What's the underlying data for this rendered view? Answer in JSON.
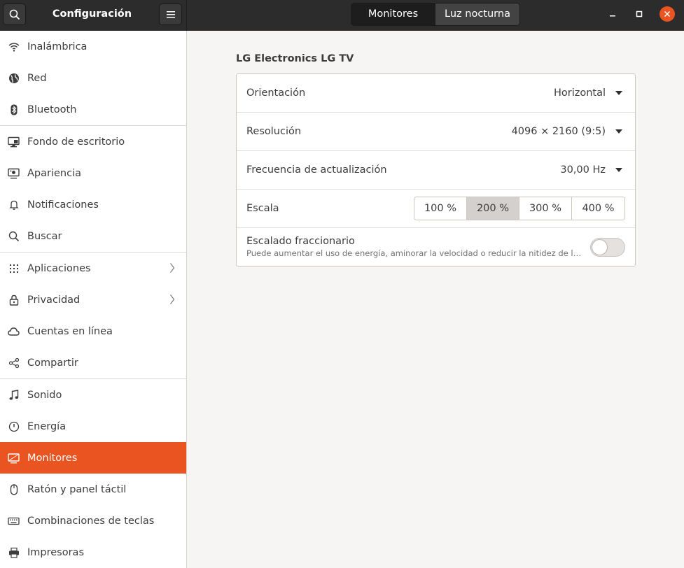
{
  "header": {
    "search_icon": "search-icon",
    "title": "Configuración",
    "menu_icon": "hamburger-icon",
    "tabs": [
      {
        "label": "Monitores"
      },
      {
        "label": "Luz nocturna"
      }
    ],
    "window_controls": [
      "minimize-icon",
      "maximize-icon",
      "close-icon"
    ]
  },
  "sidebar": {
    "items": [
      {
        "label": "Inalámbrica",
        "icon": "wifi-icon"
      },
      {
        "label": "Red",
        "icon": "network-globe-icon"
      },
      {
        "label": "Bluetooth",
        "icon": "bluetooth-icon"
      },
      {
        "label": "Fondo de escritorio",
        "icon": "wallpaper-icon"
      },
      {
        "label": "Apariencia",
        "icon": "appearance-icon"
      },
      {
        "label": "Notificaciones",
        "icon": "bell-icon"
      },
      {
        "label": "Buscar",
        "icon": "search-icon"
      },
      {
        "label": "Aplicaciones",
        "icon": "apps-grid-icon"
      },
      {
        "label": "Privacidad",
        "icon": "lock-icon"
      },
      {
        "label": "Cuentas en línea",
        "icon": "cloud-icon"
      },
      {
        "label": "Compartir",
        "icon": "share-icon"
      },
      {
        "label": "Sonido",
        "icon": "music-note-icon"
      },
      {
        "label": "Energía",
        "icon": "power-icon"
      },
      {
        "label": "Monitores",
        "icon": "display-icon"
      },
      {
        "label": "Ratón y panel táctil",
        "icon": "mouse-icon"
      },
      {
        "label": "Combinaciones de teclas",
        "icon": "keyboard-icon"
      },
      {
        "label": "Impresoras",
        "icon": "printer-icon"
      }
    ],
    "selected": "Monitores"
  },
  "main": {
    "monitor_name": "LG Electronics LG TV",
    "orientation": {
      "label": "Orientación",
      "value": "Horizontal"
    },
    "resolution": {
      "label": "Resolución",
      "value": "4096 × 2160 (9:5)"
    },
    "refresh": {
      "label": "Frecuencia de actualización",
      "value": "30,00 Hz"
    },
    "scale": {
      "label": "Escala",
      "options": [
        "100 %",
        "200 %",
        "300 %",
        "400 %"
      ],
      "selected": "200 %"
    },
    "fractional": {
      "label": "Escalado fraccionario",
      "description": "Puede aumentar el uso de energía, aminorar la velocidad o reducir la nitidez de la pantalla.",
      "enabled": false
    }
  },
  "colors": {
    "accent": "#e95420",
    "header_bg": "#2c2c2c",
    "content_bg": "#f6f5f4"
  }
}
